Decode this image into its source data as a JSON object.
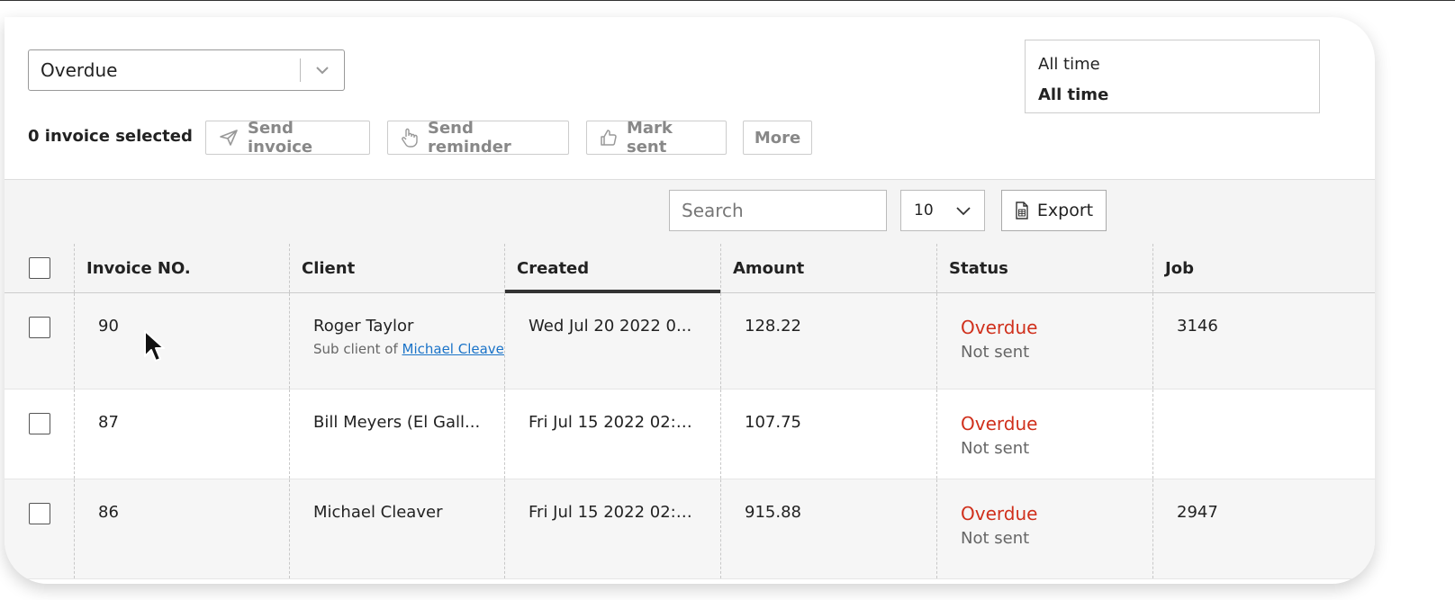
{
  "filters": {
    "status_value": "Overdue",
    "time_options": [
      "All time",
      "All time"
    ]
  },
  "actions": {
    "selected_text": "0 invoice selected",
    "send_invoice": "Send invoice",
    "send_reminder": "Send reminder",
    "mark_sent": "Mark sent",
    "more": "More"
  },
  "toolbar": {
    "search_placeholder": "Search",
    "per_page": "10",
    "export": "Export"
  },
  "table": {
    "columns": [
      "Invoice NO.",
      "Client",
      "Created",
      "Amount",
      "Status",
      "Job"
    ],
    "sorted_column": "Created",
    "rows": [
      {
        "invoice": "90",
        "client": "Roger Taylor",
        "sub_prefix": "Sub client of ",
        "sub_link": "Michael Cleaver",
        "created": "Wed Jul 20 2022 0...",
        "amount": "128.22",
        "status": "Overdue",
        "sent": "Not sent",
        "job": "3146"
      },
      {
        "invoice": "87",
        "client": "Bill Meyers (El Gall...",
        "created": "Fri Jul 15 2022 02:1...",
        "amount": "107.75",
        "status": "Overdue",
        "sent": "Not sent",
        "job": ""
      },
      {
        "invoice": "86",
        "client": "Michael Cleaver",
        "created": "Fri Jul 15 2022 02:1...",
        "amount": "915.88",
        "status": "Overdue",
        "sent": "Not sent",
        "job": "2947"
      }
    ]
  },
  "colors": {
    "overdue": "#d0301c",
    "link": "#1a73c8"
  }
}
